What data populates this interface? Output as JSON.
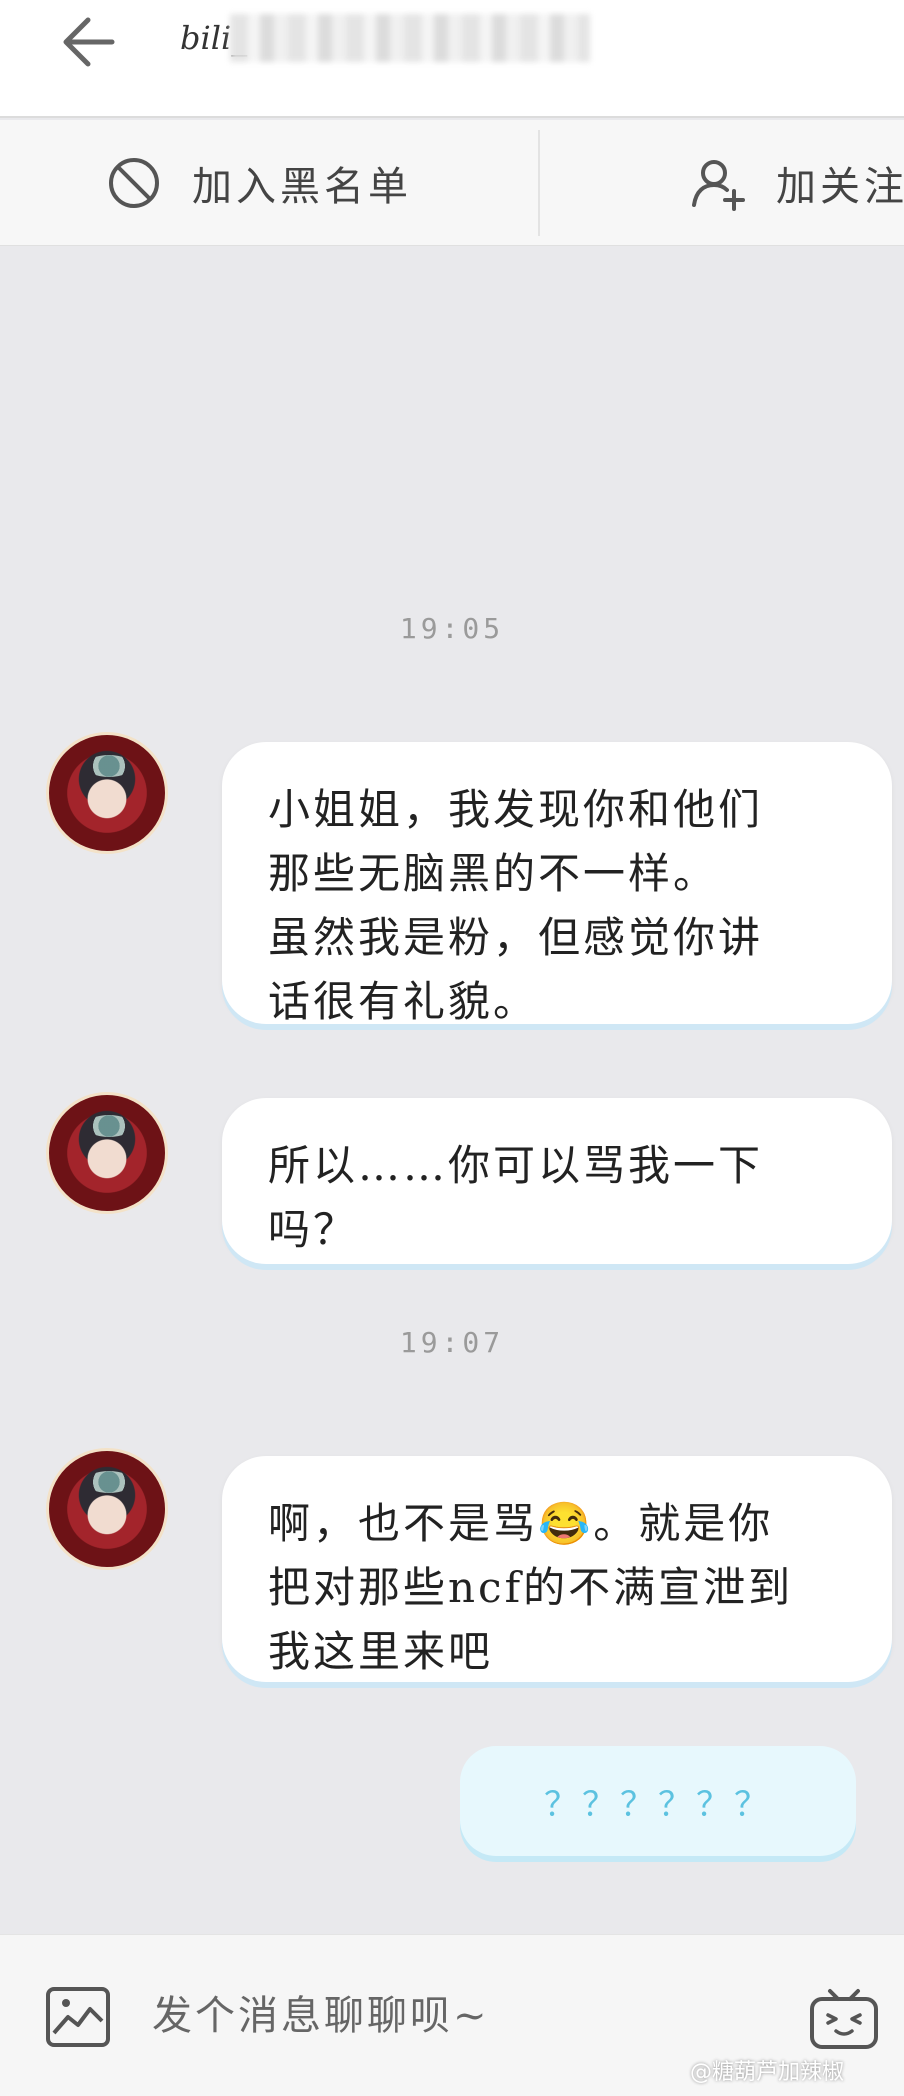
{
  "header": {
    "title": "bili_",
    "back_icon": "arrow-left-icon"
  },
  "actions": {
    "blacklist": {
      "label": "加入黑名单",
      "icon": "block-icon"
    },
    "follow": {
      "label": "加关注",
      "icon": "user-plus-icon"
    }
  },
  "chat": {
    "time_1": "19:05",
    "time_2": "19:07",
    "messages": [
      {
        "from": "other",
        "text": "小姐姐，我发现你和他们\n那些无脑黑的不一样。\n虽然我是粉，但感觉你讲\n话很有礼貌。"
      },
      {
        "from": "other",
        "text": "所以……你可以骂我一下\n吗？"
      },
      {
        "from": "other",
        "text": "啊，也不是骂😂。就是你\n把对那些ncf的不满宣泄到\n我这里来吧"
      },
      {
        "from": "self",
        "text": "？？？？？？"
      }
    ]
  },
  "input": {
    "placeholder": "发个消息聊聊呗~",
    "image_icon": "image-icon",
    "emoji_icon": "bilibili-tv-icon"
  },
  "watermark": "@糖葫芦加辣椒",
  "colors": {
    "background": "#e9e9ec",
    "self_bubble": "#e7f8fd",
    "self_text": "#5cc2e0"
  }
}
